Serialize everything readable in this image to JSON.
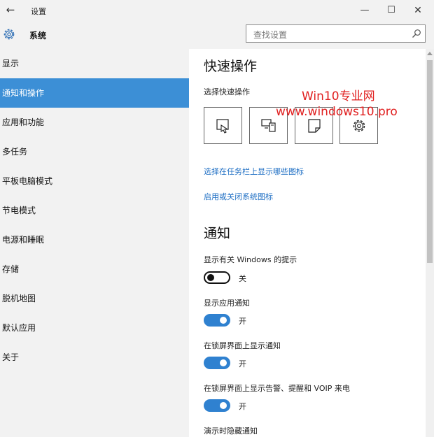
{
  "window": {
    "title": "设置",
    "back_icon": "back-arrow-icon",
    "minimize_glyph": "—",
    "maximize_glyph": "☐",
    "close_glyph": "✕"
  },
  "header": {
    "title": "系统",
    "icon": "gear-icon",
    "search_placeholder": "查找设置",
    "search_icon": "search-icon"
  },
  "sidebar": {
    "accent": "#3c8fd6",
    "items": [
      {
        "label": "显示",
        "selected": false
      },
      {
        "label": "通知和操作",
        "selected": true
      },
      {
        "label": "应用和功能",
        "selected": false
      },
      {
        "label": "多任务",
        "selected": false
      },
      {
        "label": "平板电脑模式",
        "selected": false
      },
      {
        "label": "节电模式",
        "selected": false
      },
      {
        "label": "电源和睡眠",
        "selected": false
      },
      {
        "label": "存储",
        "selected": false
      },
      {
        "label": "脱机地图",
        "selected": false
      },
      {
        "label": "默认应用",
        "selected": false
      },
      {
        "label": "关于",
        "selected": false
      }
    ]
  },
  "main": {
    "quick_actions": {
      "heading": "快速操作",
      "subheading": "选择快速操作",
      "tiles": [
        {
          "icon": "tablet-mode-icon"
        },
        {
          "icon": "project-icon"
        },
        {
          "icon": "note-icon"
        },
        {
          "icon": "settings-icon"
        }
      ]
    },
    "watermark": {
      "line1": "Win10专业网",
      "line2": "www.windows10.pro",
      "color": "#e02020"
    },
    "links": [
      "选择在任务栏上显示哪些图标",
      "启用或关闭系统图标"
    ],
    "notifications": {
      "heading": "通知",
      "settings": [
        {
          "label": "显示有关 Windows 的提示",
          "state_label": "关",
          "on": false
        },
        {
          "label": "显示应用通知",
          "state_label": "开",
          "on": true
        },
        {
          "label": "在锁屏界面上显示通知",
          "state_label": "开",
          "on": true
        },
        {
          "label": "在锁屏界面上显示告警、提醒和 VOIP 来电",
          "state_label": "开",
          "on": true
        },
        {
          "label": "演示时隐藏通知"
        }
      ]
    }
  }
}
